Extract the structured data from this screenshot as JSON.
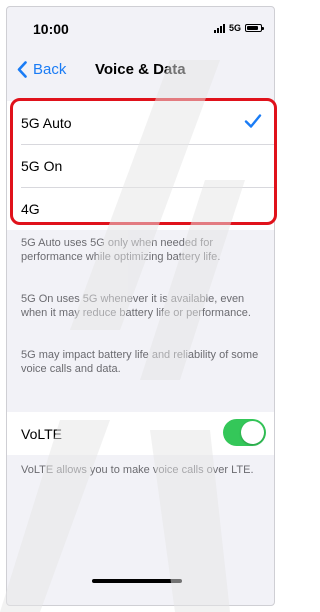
{
  "status_bar": {
    "time": "10:00",
    "network": "5G",
    "icons": [
      "signal-bars-icon",
      "battery-icon"
    ]
  },
  "nav": {
    "back_label": "Back",
    "back_icon": "chevron-left-icon",
    "title": "Voice & Data"
  },
  "options": [
    {
      "label": "5G Auto",
      "selected": true
    },
    {
      "label": "5G On",
      "selected": false
    },
    {
      "label": "4G",
      "selected": false
    }
  ],
  "notes": {
    "auto": "5G Auto uses 5G only when needed for performance while optimizing battery life.",
    "on": "5G On uses 5G whenever it is available, even when it may reduce battery life or performance.",
    "impact": "5G may impact battery life and reliability of some voice calls and data."
  },
  "volte": {
    "label": "VoLTE",
    "enabled": true,
    "note": "VoLTE allows you to make voice calls over LTE."
  },
  "colors": {
    "accent": "#1a7cf5",
    "toggle_on": "#34c759",
    "highlight": "#e0121b",
    "background": "#f2f2f7"
  }
}
